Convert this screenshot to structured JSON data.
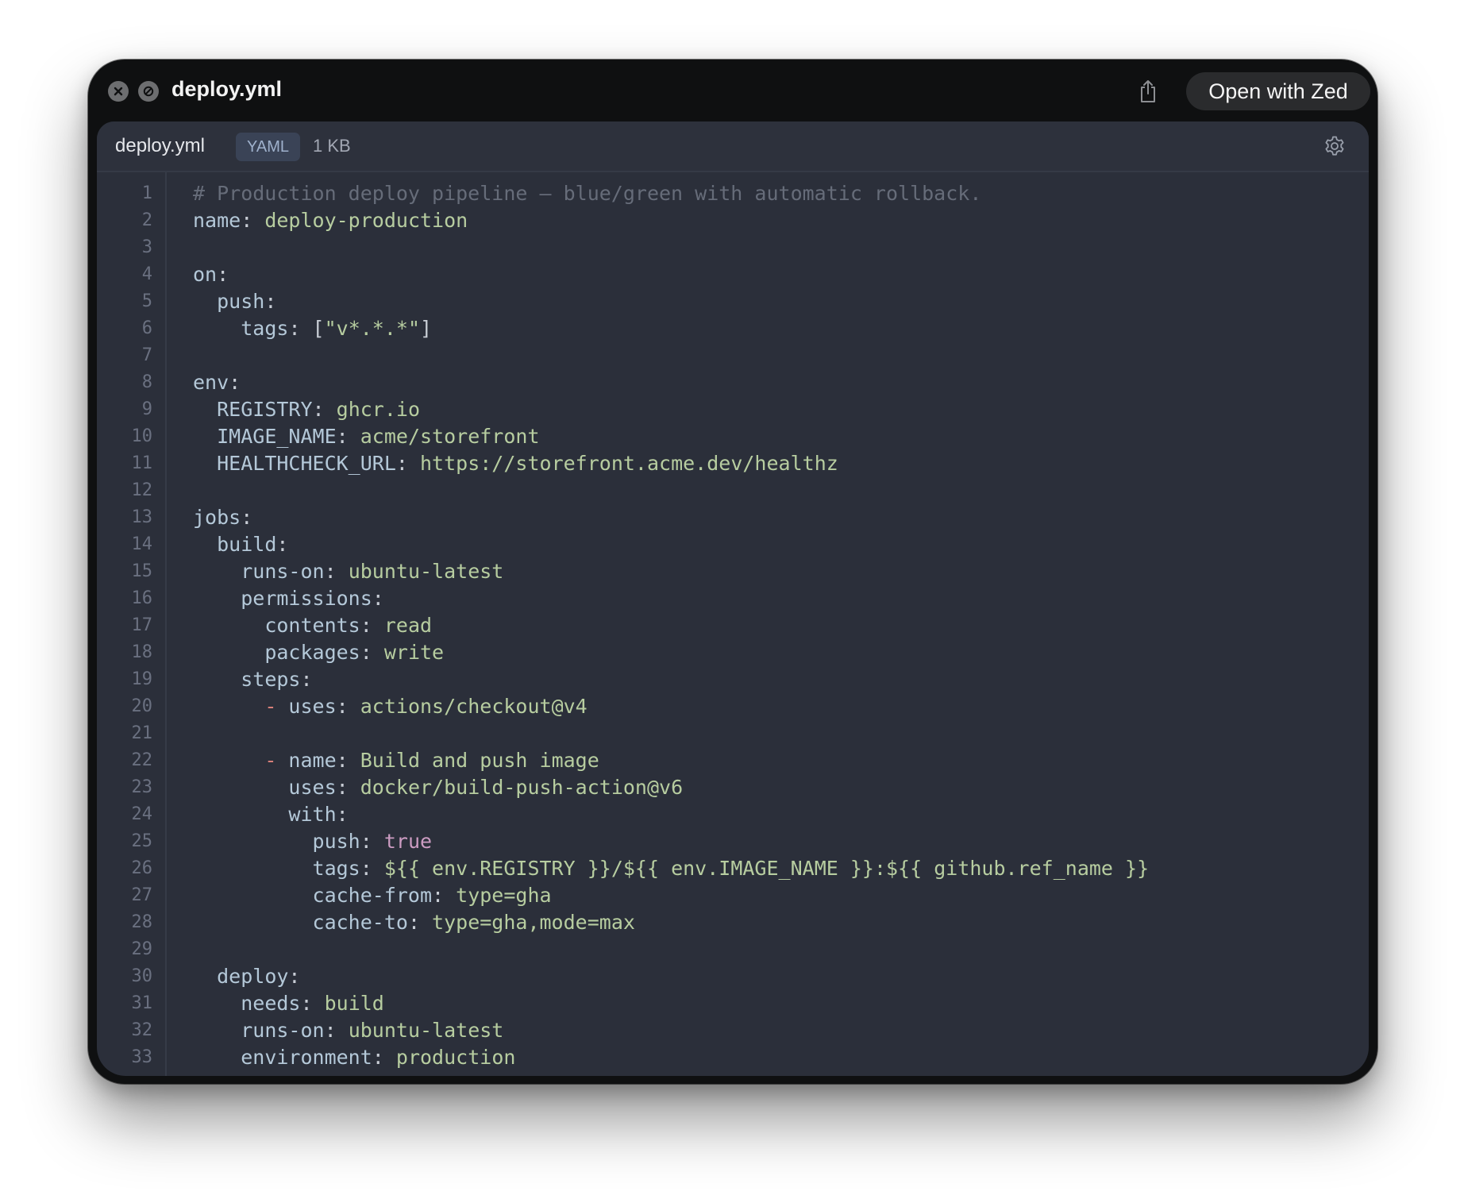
{
  "window": {
    "title": "deploy.yml",
    "open_button_label": "Open with Zed"
  },
  "file_header": {
    "filename": "deploy.yml",
    "language_badge": "YAML",
    "size": "1 KB"
  },
  "icons": {
    "close": "close-icon",
    "disabled": "no-entry-icon",
    "share": "share-icon",
    "settings": "gear-icon"
  },
  "colors": {
    "window_bg": "#0f1011",
    "editor_bg": "#2b2f3a",
    "key": "#b4c8d8",
    "string": "#b7cda0",
    "comment": "#666c79",
    "boolean": "#cc9cc2",
    "list_dash": "#d8807a",
    "line_number": "#6a7080"
  },
  "code": {
    "lines": [
      {
        "n": "1",
        "tokens": [
          {
            "t": "cmt",
            "v": "# Production deploy pipeline — blue/green with automatic rollback."
          }
        ]
      },
      {
        "n": "2",
        "tokens": [
          {
            "t": "key",
            "v": "name"
          },
          {
            "t": "punct",
            "v": ": "
          },
          {
            "t": "str",
            "v": "deploy-production"
          }
        ]
      },
      {
        "n": "3",
        "tokens": []
      },
      {
        "n": "4",
        "tokens": [
          {
            "t": "key",
            "v": "on"
          },
          {
            "t": "punct",
            "v": ":"
          }
        ]
      },
      {
        "n": "5",
        "tokens": [
          {
            "t": "plain",
            "v": "  "
          },
          {
            "t": "key",
            "v": "push"
          },
          {
            "t": "punct",
            "v": ":"
          }
        ]
      },
      {
        "n": "6",
        "tokens": [
          {
            "t": "plain",
            "v": "    "
          },
          {
            "t": "key",
            "v": "tags"
          },
          {
            "t": "punct",
            "v": ": ["
          },
          {
            "t": "str",
            "v": "\"v*.*.*\""
          },
          {
            "t": "punct",
            "v": "]"
          }
        ]
      },
      {
        "n": "7",
        "tokens": []
      },
      {
        "n": "8",
        "tokens": [
          {
            "t": "key",
            "v": "env"
          },
          {
            "t": "punct",
            "v": ":"
          }
        ]
      },
      {
        "n": "9",
        "tokens": [
          {
            "t": "plain",
            "v": "  "
          },
          {
            "t": "key",
            "v": "REGISTRY"
          },
          {
            "t": "punct",
            "v": ": "
          },
          {
            "t": "str",
            "v": "ghcr.io"
          }
        ]
      },
      {
        "n": "10",
        "tokens": [
          {
            "t": "plain",
            "v": "  "
          },
          {
            "t": "key",
            "v": "IMAGE_NAME"
          },
          {
            "t": "punct",
            "v": ": "
          },
          {
            "t": "str",
            "v": "acme/storefront"
          }
        ]
      },
      {
        "n": "11",
        "tokens": [
          {
            "t": "plain",
            "v": "  "
          },
          {
            "t": "key",
            "v": "HEALTHCHECK_URL"
          },
          {
            "t": "punct",
            "v": ": "
          },
          {
            "t": "str",
            "v": "https://storefront.acme.dev/healthz"
          }
        ]
      },
      {
        "n": "12",
        "tokens": []
      },
      {
        "n": "13",
        "tokens": [
          {
            "t": "key",
            "v": "jobs"
          },
          {
            "t": "punct",
            "v": ":"
          }
        ]
      },
      {
        "n": "14",
        "tokens": [
          {
            "t": "plain",
            "v": "  "
          },
          {
            "t": "key",
            "v": "build"
          },
          {
            "t": "punct",
            "v": ":"
          }
        ]
      },
      {
        "n": "15",
        "tokens": [
          {
            "t": "plain",
            "v": "    "
          },
          {
            "t": "key",
            "v": "runs-on"
          },
          {
            "t": "punct",
            "v": ": "
          },
          {
            "t": "str",
            "v": "ubuntu-latest"
          }
        ]
      },
      {
        "n": "16",
        "tokens": [
          {
            "t": "plain",
            "v": "    "
          },
          {
            "t": "key",
            "v": "permissions"
          },
          {
            "t": "punct",
            "v": ":"
          }
        ]
      },
      {
        "n": "17",
        "tokens": [
          {
            "t": "plain",
            "v": "      "
          },
          {
            "t": "key",
            "v": "contents"
          },
          {
            "t": "punct",
            "v": ": "
          },
          {
            "t": "str",
            "v": "read"
          }
        ]
      },
      {
        "n": "18",
        "tokens": [
          {
            "t": "plain",
            "v": "      "
          },
          {
            "t": "key",
            "v": "packages"
          },
          {
            "t": "punct",
            "v": ": "
          },
          {
            "t": "str",
            "v": "write"
          }
        ]
      },
      {
        "n": "19",
        "tokens": [
          {
            "t": "plain",
            "v": "    "
          },
          {
            "t": "key",
            "v": "steps"
          },
          {
            "t": "punct",
            "v": ":"
          }
        ]
      },
      {
        "n": "20",
        "tokens": [
          {
            "t": "plain",
            "v": "      "
          },
          {
            "t": "dash",
            "v": "- "
          },
          {
            "t": "key",
            "v": "uses"
          },
          {
            "t": "punct",
            "v": ": "
          },
          {
            "t": "str",
            "v": "actions/checkout@v4"
          }
        ]
      },
      {
        "n": "21",
        "tokens": []
      },
      {
        "n": "22",
        "tokens": [
          {
            "t": "plain",
            "v": "      "
          },
          {
            "t": "dash",
            "v": "- "
          },
          {
            "t": "key",
            "v": "name"
          },
          {
            "t": "punct",
            "v": ": "
          },
          {
            "t": "str",
            "v": "Build and push image"
          }
        ]
      },
      {
        "n": "23",
        "tokens": [
          {
            "t": "plain",
            "v": "        "
          },
          {
            "t": "key",
            "v": "uses"
          },
          {
            "t": "punct",
            "v": ": "
          },
          {
            "t": "str",
            "v": "docker/build-push-action@v6"
          }
        ]
      },
      {
        "n": "24",
        "tokens": [
          {
            "t": "plain",
            "v": "        "
          },
          {
            "t": "key",
            "v": "with"
          },
          {
            "t": "punct",
            "v": ":"
          }
        ]
      },
      {
        "n": "25",
        "tokens": [
          {
            "t": "plain",
            "v": "          "
          },
          {
            "t": "key",
            "v": "push"
          },
          {
            "t": "punct",
            "v": ": "
          },
          {
            "t": "bool",
            "v": "true"
          }
        ]
      },
      {
        "n": "26",
        "tokens": [
          {
            "t": "plain",
            "v": "          "
          },
          {
            "t": "key",
            "v": "tags"
          },
          {
            "t": "punct",
            "v": ": "
          },
          {
            "t": "str",
            "v": "${{ env.REGISTRY }}/${{ env.IMAGE_NAME }}:${{ github.ref_name }}"
          }
        ]
      },
      {
        "n": "27",
        "tokens": [
          {
            "t": "plain",
            "v": "          "
          },
          {
            "t": "key",
            "v": "cache-from"
          },
          {
            "t": "punct",
            "v": ": "
          },
          {
            "t": "str",
            "v": "type=gha"
          }
        ]
      },
      {
        "n": "28",
        "tokens": [
          {
            "t": "plain",
            "v": "          "
          },
          {
            "t": "key",
            "v": "cache-to"
          },
          {
            "t": "punct",
            "v": ": "
          },
          {
            "t": "str",
            "v": "type=gha,mode=max"
          }
        ]
      },
      {
        "n": "29",
        "tokens": []
      },
      {
        "n": "30",
        "tokens": [
          {
            "t": "plain",
            "v": "  "
          },
          {
            "t": "key",
            "v": "deploy"
          },
          {
            "t": "punct",
            "v": ":"
          }
        ]
      },
      {
        "n": "31",
        "tokens": [
          {
            "t": "plain",
            "v": "    "
          },
          {
            "t": "key",
            "v": "needs"
          },
          {
            "t": "punct",
            "v": ": "
          },
          {
            "t": "str",
            "v": "build"
          }
        ]
      },
      {
        "n": "32",
        "tokens": [
          {
            "t": "plain",
            "v": "    "
          },
          {
            "t": "key",
            "v": "runs-on"
          },
          {
            "t": "punct",
            "v": ": "
          },
          {
            "t": "str",
            "v": "ubuntu-latest"
          }
        ]
      },
      {
        "n": "33",
        "tokens": [
          {
            "t": "plain",
            "v": "    "
          },
          {
            "t": "key",
            "v": "environment"
          },
          {
            "t": "punct",
            "v": ": "
          },
          {
            "t": "str",
            "v": "production"
          }
        ]
      }
    ]
  }
}
